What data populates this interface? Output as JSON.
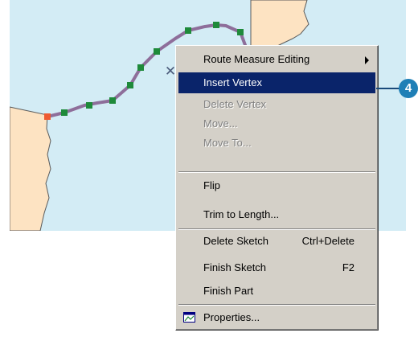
{
  "map": {
    "cursor_glyph": "✕",
    "colors": {
      "water": "#d3ecf5",
      "land": "#fde3c2",
      "route": "#8e6e9a",
      "vertex": "#1e8a3a",
      "start_vertex": "#ee5a30"
    }
  },
  "context_menu": {
    "items": [
      {
        "label": "Route Measure Editing",
        "shortcut": "",
        "state": "normal",
        "submenu": true
      },
      {
        "label": "Insert Vertex",
        "shortcut": "",
        "state": "highlighted"
      },
      {
        "label": "Delete Vertex",
        "shortcut": "",
        "state": "disabled"
      },
      {
        "label": "Move...",
        "shortcut": "",
        "state": "disabled"
      },
      {
        "label": "Move To...",
        "shortcut": "",
        "state": "disabled"
      },
      {
        "label": "Flip",
        "shortcut": "",
        "state": "normal"
      },
      {
        "label": "Trim to Length...",
        "shortcut": "",
        "state": "normal"
      },
      {
        "label": "Delete Sketch",
        "shortcut": "Ctrl+Delete",
        "state": "normal"
      },
      {
        "label": "Finish Sketch",
        "shortcut": "F2",
        "state": "normal"
      },
      {
        "label": "Finish Part",
        "shortcut": "",
        "state": "normal"
      },
      {
        "label": "Properties...",
        "shortcut": "",
        "state": "normal",
        "icon": "properties-icon"
      }
    ]
  },
  "callout": {
    "number": "4",
    "color": "#1f7fb6"
  }
}
